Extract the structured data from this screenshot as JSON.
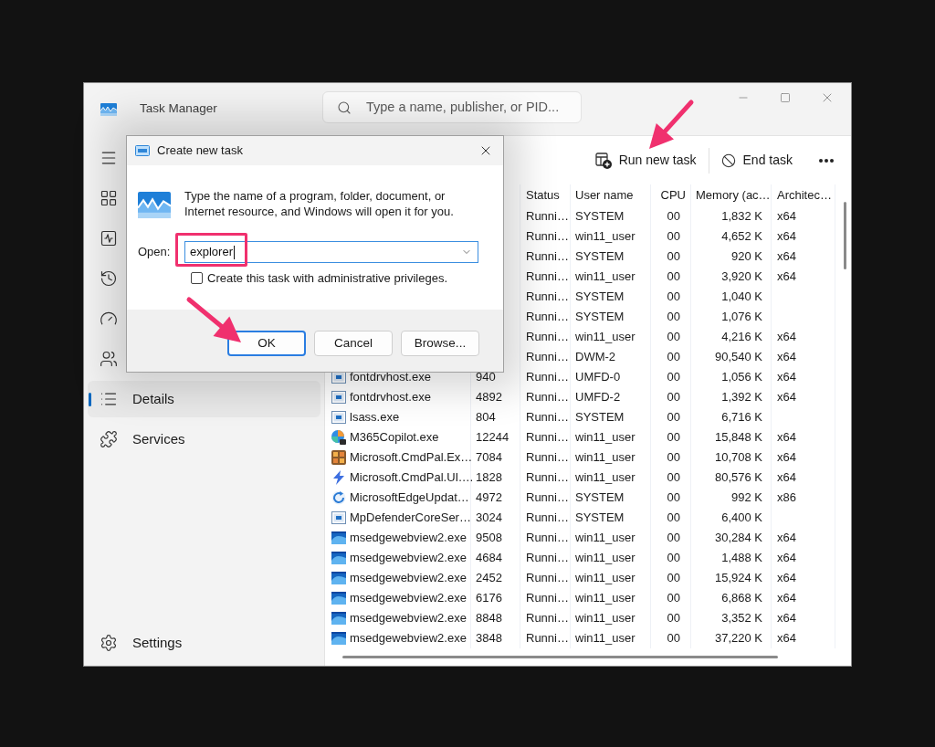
{
  "window": {
    "title": "Task Manager"
  },
  "search": {
    "placeholder": "Type a name, publisher, or PID..."
  },
  "sidebar": {
    "items": [
      {
        "selected": false
      },
      {
        "selected": false
      },
      {
        "selected": false
      },
      {
        "selected": false
      },
      {
        "selected": false
      },
      {
        "label": "Details",
        "selected": true
      },
      {
        "label": "Services",
        "selected": false
      }
    ],
    "settings": {
      "label": "Settings"
    }
  },
  "toolbar": {
    "buttons": [
      {
        "label": "Run new task"
      },
      {
        "label": "End task"
      }
    ]
  },
  "table": {
    "columns": [
      {
        "label": "Status"
      },
      {
        "label": "User name"
      },
      {
        "label": "CPU"
      },
      {
        "label": "Memory (ac…"
      },
      {
        "label": "Architec…"
      }
    ],
    "rows": [
      {
        "status": "Runni…",
        "user_name": "SYSTEM",
        "cpu": "00",
        "memory": "1,832 K",
        "architecture": "x64"
      },
      {
        "status": "Runni…",
        "user_name": "win11_user",
        "cpu": "00",
        "memory": "4,652 K",
        "architecture": "x64"
      },
      {
        "status": "Runni…",
        "user_name": "SYSTEM",
        "cpu": "00",
        "memory": "920 K",
        "architecture": "x64"
      },
      {
        "status": "Runni…",
        "user_name": "win11_user",
        "cpu": "00",
        "memory": "3,920 K",
        "architecture": "x64"
      },
      {
        "status": "Runni…",
        "user_name": "SYSTEM",
        "cpu": "00",
        "memory": "1,040 K"
      },
      {
        "status": "Runni…",
        "user_name": "SYSTEM",
        "cpu": "00",
        "memory": "1,076 K"
      },
      {
        "status": "Runni…",
        "user_name": "win11_user",
        "cpu": "00",
        "memory": "4,216 K",
        "architecture": "x64"
      },
      {
        "status": "Runni…",
        "user_name": "DWM-2",
        "cpu": "00",
        "memory": "90,540 K",
        "architecture": "x64"
      },
      {
        "kind": "service",
        "name": "fontdrvhost.exe",
        "pid": "940",
        "status": "Runni…",
        "user_name": "UMFD-0",
        "cpu": "00",
        "memory": "1,056 K",
        "architecture": "x64"
      },
      {
        "kind": "service",
        "name": "fontdrvhost.exe",
        "pid": "4892",
        "status": "Runni…",
        "user_name": "UMFD-2",
        "cpu": "00",
        "memory": "1,392 K",
        "architecture": "x64"
      },
      {
        "kind": "service",
        "name": "lsass.exe",
        "pid": "804",
        "status": "Runni…",
        "user_name": "SYSTEM",
        "cpu": "00",
        "memory": "6,716 K"
      },
      {
        "kind": "copilot",
        "name": "M365Copilot.exe",
        "pid": "12244",
        "status": "Runni…",
        "user_name": "win11_user",
        "cpu": "00",
        "memory": "15,848 K",
        "architecture": "x64"
      },
      {
        "kind": "extension",
        "name": "Microsoft.CmdPal.Ex…",
        "pid": "7084",
        "status": "Runni…",
        "user_name": "win11_user",
        "cpu": "00",
        "memory": "10,708 K",
        "architecture": "x64"
      },
      {
        "kind": "palette",
        "name": "Microsoft.CmdPal.UI.…",
        "pid": "1828",
        "status": "Runni…",
        "user_name": "win11_user",
        "cpu": "00",
        "memory": "80,576 K",
        "architecture": "x64"
      },
      {
        "kind": "updater",
        "name": "MicrosoftEdgeUpdat…",
        "pid": "4972",
        "status": "Runni…",
        "user_name": "SYSTEM",
        "cpu": "00",
        "memory": "992 K",
        "architecture": "x86"
      },
      {
        "kind": "service",
        "name": "MpDefenderCoreSer…",
        "pid": "3024",
        "status": "Runni…",
        "user_name": "SYSTEM",
        "cpu": "00",
        "memory": "6,400 K"
      },
      {
        "kind": "webview",
        "name": "msedgewebview2.exe",
        "pid": "9508",
        "status": "Runni…",
        "user_name": "win11_user",
        "cpu": "00",
        "memory": "30,284 K",
        "architecture": "x64"
      },
      {
        "kind": "webview",
        "name": "msedgewebview2.exe",
        "pid": "4684",
        "status": "Runni…",
        "user_name": "win11_user",
        "cpu": "00",
        "memory": "1,488 K",
        "architecture": "x64"
      },
      {
        "kind": "webview",
        "name": "msedgewebview2.exe",
        "pid": "2452",
        "status": "Runni…",
        "user_name": "win11_user",
        "cpu": "00",
        "memory": "15,924 K",
        "architecture": "x64"
      },
      {
        "kind": "webview",
        "name": "msedgewebview2.exe",
        "pid": "6176",
        "status": "Runni…",
        "user_name": "win11_user",
        "cpu": "00",
        "memory": "6,868 K",
        "architecture": "x64"
      },
      {
        "kind": "webview",
        "name": "msedgewebview2.exe",
        "pid": "8848",
        "status": "Runni…",
        "user_name": "win11_user",
        "cpu": "00",
        "memory": "3,352 K",
        "architecture": "x64"
      },
      {
        "kind": "webview",
        "name": "msedgewebview2.exe",
        "pid": "3848",
        "status": "Runni…",
        "user_name": "win11_user",
        "cpu": "00",
        "memory": "37,220 K",
        "architecture": "x64"
      }
    ]
  },
  "dialog": {
    "title": "Create new task",
    "message": "Type the name of a program, folder, document, or Internet resource, and Windows will open it for you.",
    "open_label": "Open:",
    "open_value": "explorer",
    "admin_checkbox": {
      "label": "Create this task with administrative privileges.",
      "checked": false
    },
    "buttons": [
      {
        "label": "OK",
        "default": true
      },
      {
        "label": "Cancel",
        "default": false
      },
      {
        "label": "Browse...",
        "default": false
      }
    ]
  }
}
